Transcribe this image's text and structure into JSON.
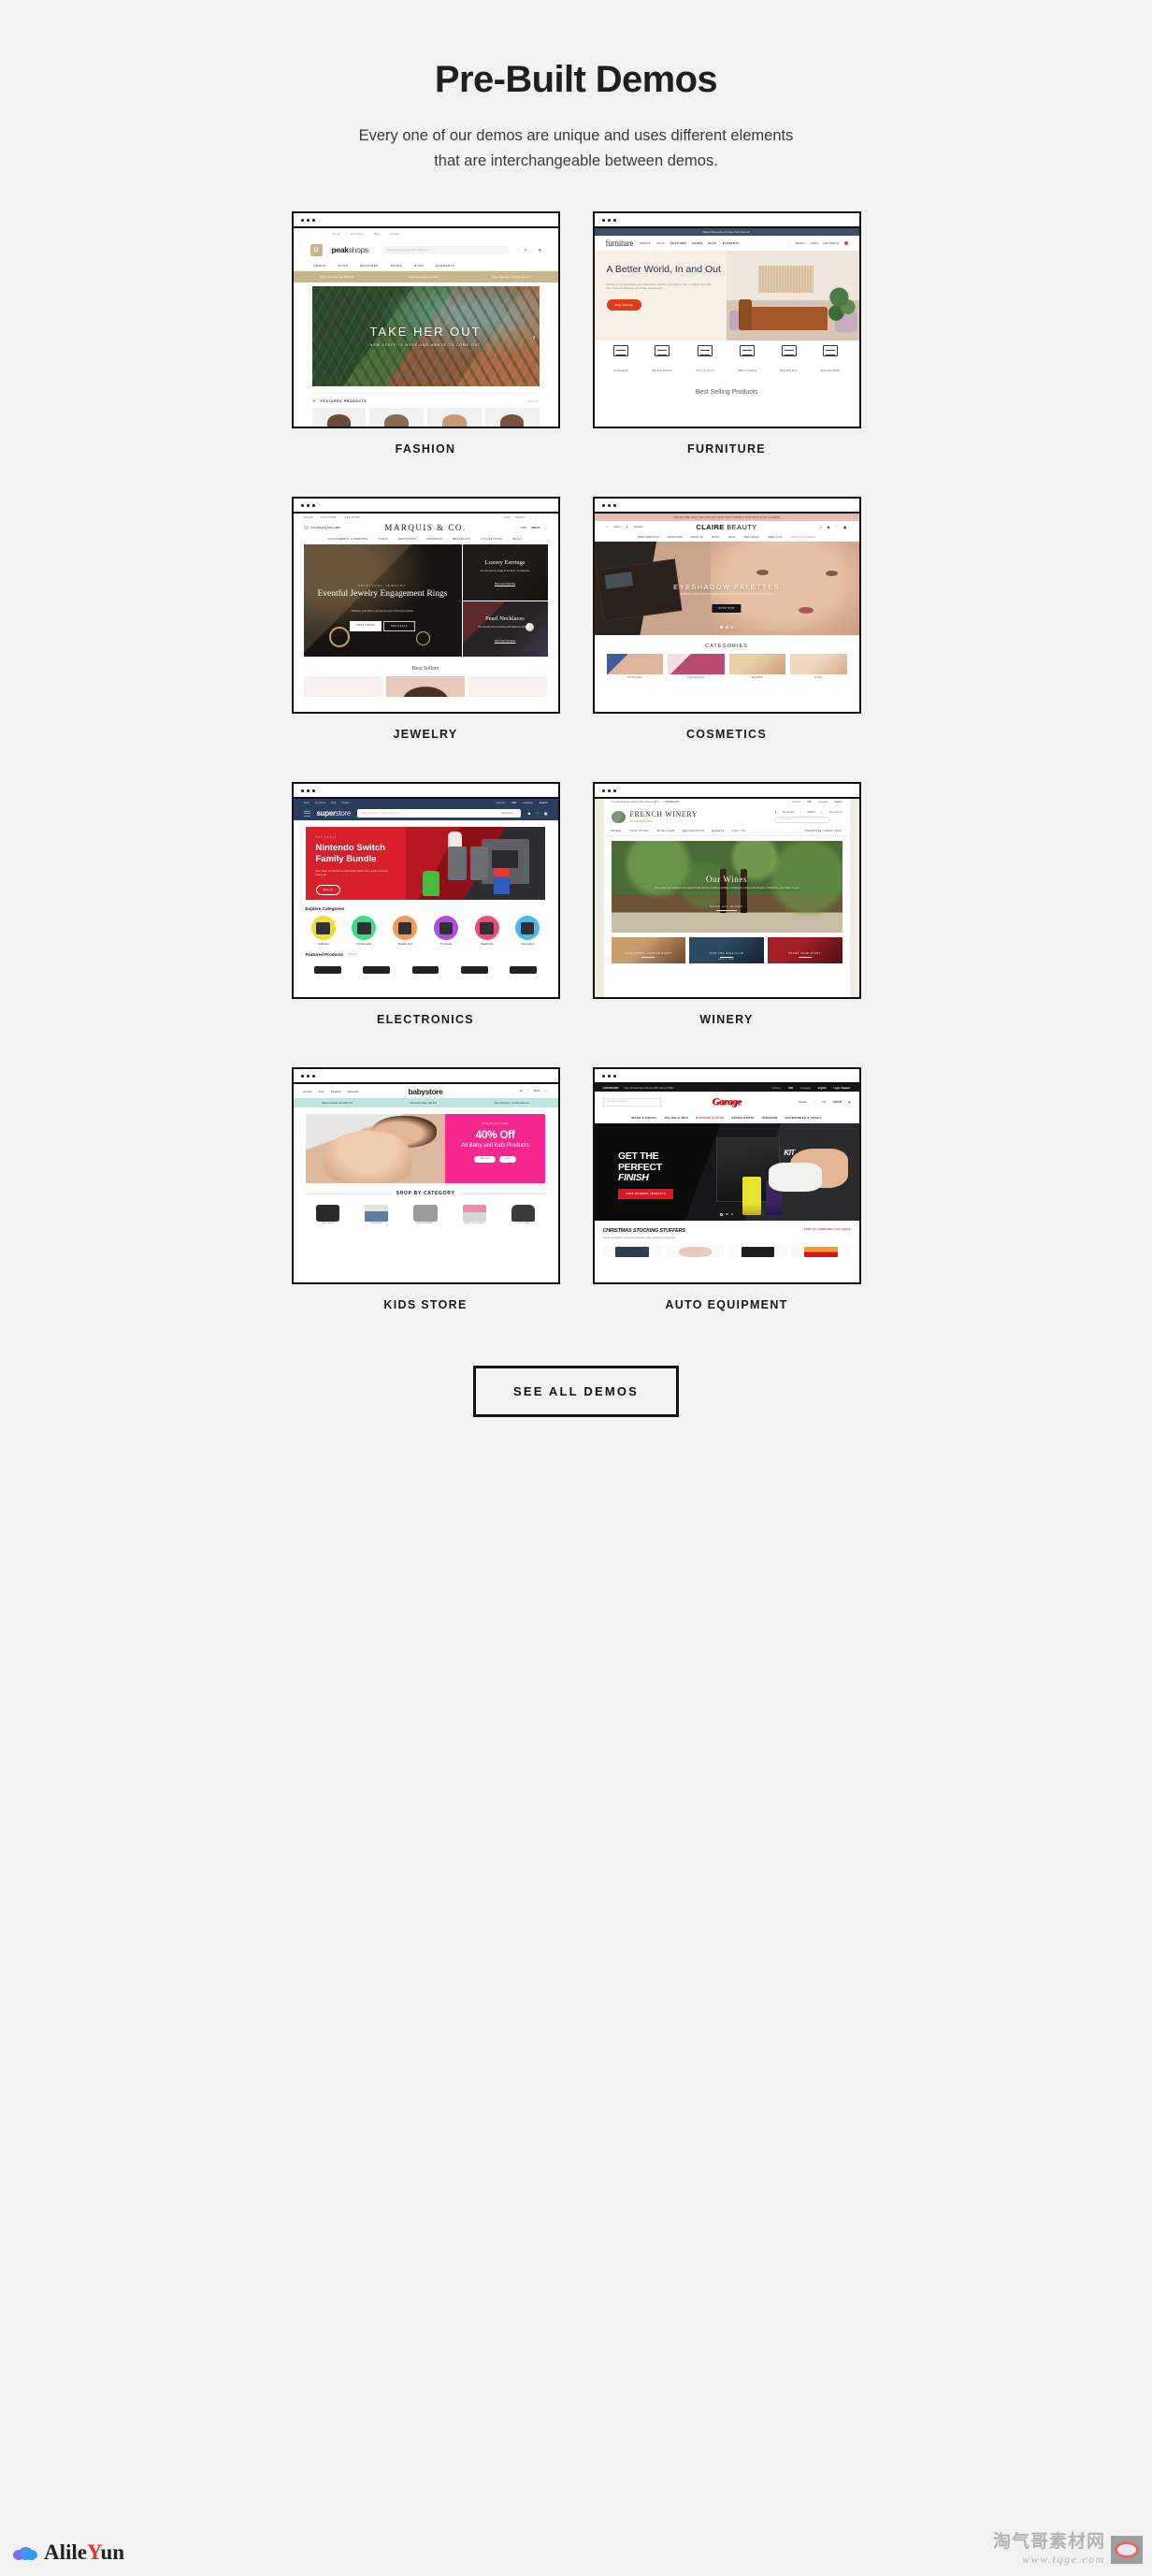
{
  "header": {
    "title": "Pre-Built Demos",
    "subtitle_line1": "Every one of our demos are unique and uses different elements",
    "subtitle_line2": "that are interchangeable between demos."
  },
  "cta": {
    "label": "SEE ALL DEMOS"
  },
  "demos": [
    {
      "label": "FASHION",
      "brand_bold": "peak",
      "brand_light": "shops",
      "topnav": [
        "About",
        "Our Stores",
        "Blog",
        "Contact"
      ],
      "search_placeholder": "Search for items, brands, articles etc.",
      "search_scope": "Everything",
      "menu": [
        "DEMOS",
        "SHOP",
        "FEATURES",
        "PAGES",
        "BLOG",
        "ELEMENTS"
      ],
      "account": "Account",
      "wishlist": "Wishlist",
      "cart": "Cart",
      "promo": [
        "Refer a Friend, Get 20% Off",
        "Subscribe today, Get $10",
        "Free Shipping + 30 Day Returns"
      ],
      "hero_title": "TAKE HER OUT",
      "hero_sub": "NEW STUFF IS HERE AND WANTS TO COME OUT",
      "featured_title": "FEATURED PRODUCTS",
      "featured_link": "Shop all"
    },
    {
      "label": "FURNITURE",
      "brand": "furniture",
      "announcement": "Black Friday deals end today. Don't miss out.",
      "menu": [
        "DEMOS",
        "SHOP",
        "FEATURES",
        "PAGES",
        "BLOG",
        "ELEMENTS"
      ],
      "utility": [
        "SEARCH",
        "LOGIN",
        "CART  $182.52"
      ],
      "cart_count": "2",
      "hero_title": "A Better World, In and Out",
      "hero_text": "Fashion to me has become very disposable; I wanted to get back to craft, to clothes that could last. I have an obsession with details and patterns.",
      "hero_cta": "Shop Collection",
      "categories": [
        "Living Room",
        "Dining & Kitchen",
        "Tables & Chairs",
        "Office Furniture",
        "Kids Furniture",
        "Sectional Sofas"
      ],
      "active_category": "Tables & Chairs",
      "section_title": "Best Selling Products"
    },
    {
      "label": "JEWELRY",
      "brand": "MARQUIS & CO.",
      "top_left": [
        "ENGLISH",
        "FIND A STORE",
        "+1.800.123.6891"
      ],
      "top_right": [
        "LOGIN",
        "WISHLIST"
      ],
      "shipping_note": "Free Shipping Orders $80+",
      "cart_label": "CART",
      "cart_value": "$380.25",
      "cart_count": "3",
      "menu": [
        "ENGAGEMENT & WEDDING",
        "RINGS",
        "NECKLACES",
        "EARRINGS",
        "BRACELETS",
        "COLLECTIONS",
        "DEALS"
      ],
      "hero_eyebrow": "SPIRITUAL JEWELRY",
      "hero_title": "Eventful Jewelry Engagement Rings",
      "hero_sub": "Whatever your faith is, you can be sure to find some sparkle",
      "hero_btn1": "SHOP RINGS",
      "hero_btn2": "SEE DEALS",
      "tile1_title": "Luxury Earrings",
      "tile1_sub": "You can't just buy things for the label - it's ridiculous.",
      "tile1_link": "Shop Luxury Earrings",
      "tile2_title": "Pearl Necklaces",
      "tile2_sub": "The only way to do something with depth is to work hard.",
      "tile2_link": "Shop Pearl Necklaces",
      "section_title": "Best Sellers"
    },
    {
      "label": "COSMETICS",
      "brand_bold": "CLAIRE",
      "brand_light": "BEAUTY",
      "announcement": "LIMITED TIME ONLY! GET 15% OFF YOUR FIRST ORDER IN 2020 WITH CODE CLAIRE08",
      "nav_left": [
        "Stores",
        "Rewards"
      ],
      "menu": [
        "NEW ARRIVALS",
        "SKINCARE",
        "MAKE UP",
        "BODY",
        "HAIR",
        "WELLNESS",
        "ABOUT US",
        "SPECIAL OFFERS"
      ],
      "highlight_menu": "SPECIAL OFFERS",
      "hero_title": "EYESHADOW PALETTES",
      "hero_sub": "REFRESH YOUR LOOK WITH THESE BEST-SELLING EVERYDAY MAKEUP ESSENTIALS",
      "hero_cta": "SHOP NOW",
      "section_title": "CATEGORIES",
      "categories": [
        "SKINCARE",
        "FRAGRANCE",
        "MAKEUP",
        "EYES"
      ]
    },
    {
      "label": "ELECTRONICS",
      "brand_bold": "super",
      "brand_light": "store",
      "topnav": [
        "About",
        "Our Stores",
        "Blog",
        "Contact"
      ],
      "currency_label": "Currency",
      "currency_value": "USD",
      "language_label": "Language",
      "language_value": "English",
      "search_placeholder": "Search for items, brands, articles etc.",
      "search_scope": "Everything",
      "hero_kicker": "HOT DEALS",
      "hero_title": "Nintendo Switch Family Bundle",
      "hero_text": "Even better, it's the latest version of the Switch with a vastly improved battery life.",
      "hero_cta": "Shop now",
      "explore_title": "Explore Categories",
      "categories": [
        "Cellphones",
        "Portable Audio",
        "Wearable Tech",
        "PC Gaming",
        "Headphones",
        "Video Games"
      ],
      "featured_title": "Featured Products",
      "featured_link": "View all"
    },
    {
      "label": "WINERY",
      "brand": "FRENCH WINERY",
      "brand_tagline": "Vineyard & Farm",
      "shipping_note": "Free Standard Rate Shipping With Orders Of $50+",
      "phone": "1-840-849-2340",
      "currency_label": "Currency",
      "currency_value": "USD",
      "language_label": "Language",
      "language_value": "English",
      "account_links": [
        "My Account",
        "Wishlist",
        "View Cart (1)"
      ],
      "search_placeholder": "Find a product",
      "menu": [
        "WINES",
        "YOUR STORY",
        "WINE CLUB",
        "RECOGNITION",
        "EVENTS",
        "VISIT US"
      ],
      "menu_right": "PURCHASE TODAY ($59)",
      "hero_title": "Our Wines",
      "hero_text": "Our grapes are unique to the region from and its coastal proximity, resulting in wines with nuance, complexity, and fresh coastal",
      "hero_cta": "SHOP ALL WINES",
      "cards": [
        {
          "title": "TRADITIONAL TASTING EVENT",
          "sub": ""
        },
        {
          "title": "JOIN THE WINE CLUB",
          "sub": "APPLY NOW"
        },
        {
          "title": "SHARE YOUR STORY",
          "sub": ""
        }
      ]
    },
    {
      "label": "KIDS STORE",
      "brand": "babystore",
      "menu": [
        "Demos",
        "Shop",
        "Features",
        "Elements"
      ],
      "cart_value": "$0.00",
      "cart_count": "2",
      "promo": [
        "Refer a Friend, Get 20% Off",
        "Subscribe today, Get $10",
        "Free Shipping + 30 Day Returns"
      ],
      "hero_kicker": "Great gifts, great prices!",
      "hero_percent": "40% Off",
      "hero_sub": "All Baby and Kids Products",
      "hero_pills": [
        "BABY BOY",
        "KIDS"
      ],
      "section_title": "SHOP BY CATEGORY",
      "categories": [
        "CAR SEATS",
        "FEEDING",
        "HIGHCHAIRS",
        "KIDS CLOTHING",
        "STROLLERS"
      ]
    },
    {
      "label": "AUTO EQUIPMENT",
      "brand": "Garage",
      "phone": "1-840-849-2340",
      "shipping_note": "Free Standard Rate Shipping With Orders Of $50+",
      "currency_label": "Currency",
      "currency_value": "USD",
      "language_label": "Language",
      "language_value": "English",
      "login_label": "Login / Register",
      "search_placeholder": "Search for products",
      "wishlist_label": "Wishlist",
      "cart_label": "Cart:",
      "cart_value": "$100.98",
      "menu": [
        "WASH & DETAIL",
        "POLISH & WAX",
        "BUFFERS & PADS",
        "SPARE PARTS",
        "INTERIOR",
        "ACCESORIES & TOOLS"
      ],
      "highlight_menu": "BUFFERS & PADS",
      "hero_title_1": "GET THE",
      "hero_title_2": "PERFECT",
      "hero_title_3": "FINISH",
      "hero_cta": "SHOP INTERIOR PRODUCTS",
      "section_title": "CHRISTMAS STOCKING STUFFERS",
      "section_sub": "Attention to detail is of utmost importance when you want to look good.",
      "section_link": "SHOP ALL CHRISTMAS GIFT IDEAS"
    }
  ],
  "watermarks": {
    "left_text_a": "Alile",
    "left_text_b": "Y",
    "left_text_c": "un",
    "right_zh": "淘气哥素材网",
    "right_url": "www.tqge.com"
  }
}
